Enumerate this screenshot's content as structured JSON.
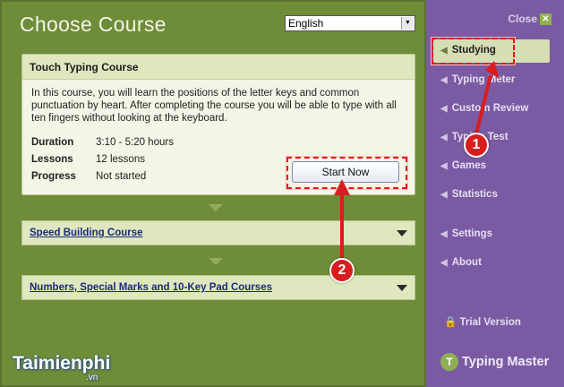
{
  "header": {
    "title": "Choose Course",
    "language": "English"
  },
  "current_course": {
    "name": "Touch Typing Course",
    "description": "In this course, you will learn the positions of the letter keys and common punctuation by heart. After completing the course you will be able to type with all ten fingers without looking at the keyboard.",
    "duration_label": "Duration",
    "duration_value": "3:10 - 5:20 hours",
    "lessons_label": "Lessons",
    "lessons_value": "12 lessons",
    "progress_label": "Progress",
    "progress_value": "Not started",
    "start_label": "Start Now"
  },
  "other_courses": [
    {
      "name": "Speed Building Course"
    },
    {
      "name": "Numbers, Special Marks and 10-Key Pad Courses"
    }
  ],
  "sidebar": {
    "close_label": "Close",
    "items": [
      {
        "label": "Studying",
        "active": true
      },
      {
        "label": "Typing Meter"
      },
      {
        "label": "Custom Review"
      },
      {
        "label": "Typing Test"
      },
      {
        "label": "Games"
      },
      {
        "label": "Statistics"
      },
      {
        "label": "Settings"
      },
      {
        "label": "About"
      }
    ],
    "trial_label": "Trial Version",
    "brand": "Typing Master"
  },
  "annotations": {
    "step1": "1",
    "step2": "2",
    "watermark": "Taimienphi",
    "watermark_domain": ".vn"
  },
  "colors": {
    "annotation_red": "#d81d1f",
    "main_green": "#6f8c39",
    "sidebar_purple": "#7a5aa3"
  }
}
